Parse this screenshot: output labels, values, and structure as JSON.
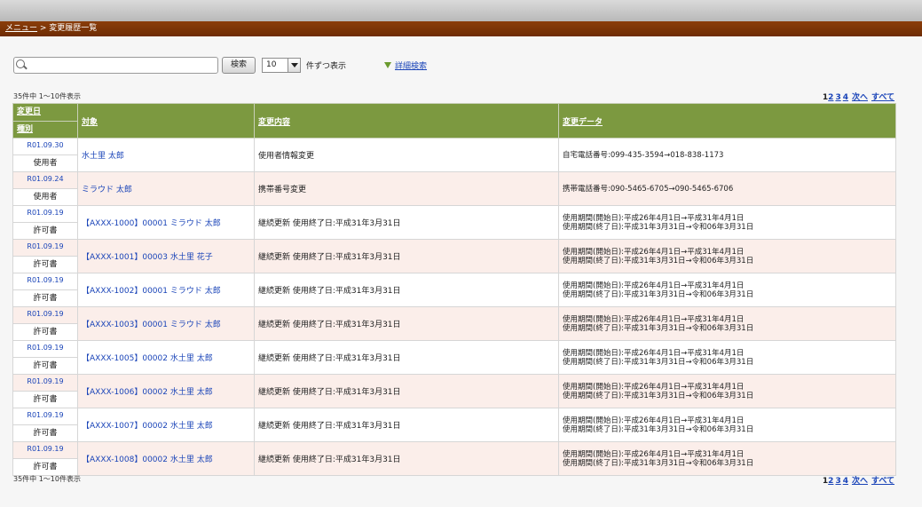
{
  "breadcrumb": {
    "menu": "メニュー",
    "separator": " > ",
    "current": "変更履歴一覧"
  },
  "search": {
    "placeholder": "",
    "button": "検索",
    "count": "10",
    "per_page": "件ずつ表示",
    "advanced": "詳細検索"
  },
  "summary_text": "35件中 1〜10件表示",
  "pagination": {
    "pages": [
      "1",
      "2",
      "3",
      "4"
    ],
    "next": "次へ",
    "all": "すべて"
  },
  "headers": {
    "date": "変更日",
    "type": "種別",
    "target": "対象",
    "content": "変更内容",
    "data": "変更データ"
  },
  "rows": [
    {
      "date": "R01.09.30",
      "type": "使用者",
      "target": "水土里 太郎",
      "content": "使用者情報変更",
      "data": [
        "自宅電話番号:099-435-3594→018-838-1173"
      ]
    },
    {
      "date": "R01.09.24",
      "type": "使用者",
      "target": "ミラウド 太郎",
      "content": "携帯番号変更",
      "data": [
        "携帯電話番号:090-5465-6705→090-5465-6706"
      ]
    },
    {
      "date": "R01.09.19",
      "type": "許可書",
      "target": "【AXXX-1000】00001 ミラウド 太郎",
      "content": "継続更新 使用終了日:平成31年3月31日",
      "data": [
        "使用期間(開始日):平成26年4月1日→平成31年4月1日",
        "使用期間(終了日):平成31年3月31日→令和06年3月31日"
      ]
    },
    {
      "date": "R01.09.19",
      "type": "許可書",
      "target": "【AXXX-1001】00003 水土里 花子",
      "content": "継続更新 使用終了日:平成31年3月31日",
      "data": [
        "使用期間(開始日):平成26年4月1日→平成31年4月1日",
        "使用期間(終了日):平成31年3月31日→令和06年3月31日"
      ]
    },
    {
      "date": "R01.09.19",
      "type": "許可書",
      "target": "【AXXX-1002】00001 ミラウド 太郎",
      "content": "継続更新 使用終了日:平成31年3月31日",
      "data": [
        "使用期間(開始日):平成26年4月1日→平成31年4月1日",
        "使用期間(終了日):平成31年3月31日→令和06年3月31日"
      ]
    },
    {
      "date": "R01.09.19",
      "type": "許可書",
      "target": "【AXXX-1003】00001 ミラウド 太郎",
      "content": "継続更新 使用終了日:平成31年3月31日",
      "data": [
        "使用期間(開始日):平成26年4月1日→平成31年4月1日",
        "使用期間(終了日):平成31年3月31日→令和06年3月31日"
      ]
    },
    {
      "date": "R01.09.19",
      "type": "許可書",
      "target": "【AXXX-1005】00002 水土里 太郎",
      "content": "継続更新 使用終了日:平成31年3月31日",
      "data": [
        "使用期間(開始日):平成26年4月1日→平成31年4月1日",
        "使用期間(終了日):平成31年3月31日→令和06年3月31日"
      ]
    },
    {
      "date": "R01.09.19",
      "type": "許可書",
      "target": "【AXXX-1006】00002 水土里 太郎",
      "content": "継続更新 使用終了日:平成31年3月31日",
      "data": [
        "使用期間(開始日):平成26年4月1日→平成31年4月1日",
        "使用期間(終了日):平成31年3月31日→令和06年3月31日"
      ]
    },
    {
      "date": "R01.09.19",
      "type": "許可書",
      "target": "【AXXX-1007】00002 水土里 太郎",
      "content": "継続更新 使用終了日:平成31年3月31日",
      "data": [
        "使用期間(開始日):平成26年4月1日→平成31年4月1日",
        "使用期間(終了日):平成31年3月31日→令和06年3月31日"
      ]
    },
    {
      "date": "R01.09.19",
      "type": "許可書",
      "target": "【AXXX-1008】00002 水土里 太郎",
      "content": "継続更新 使用終了日:平成31年3月31日",
      "data": [
        "使用期間(開始日):平成26年4月1日→平成31年4月1日",
        "使用期間(終了日):平成31年3月31日→令和06年3月31日"
      ]
    }
  ]
}
